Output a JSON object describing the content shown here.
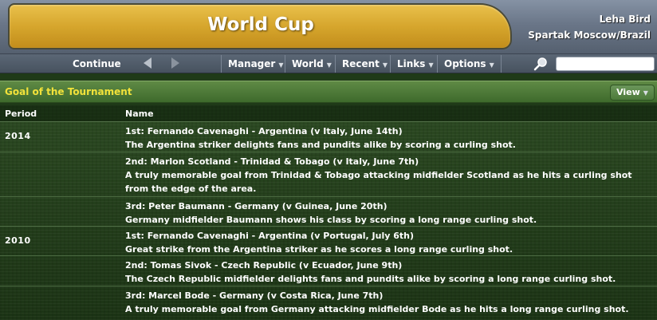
{
  "header": {
    "title": "World Cup",
    "user_name": "Leha Bird",
    "user_team": "Spartak Moscow/Brazil"
  },
  "toolbar": {
    "continue_label": "Continue",
    "menus": [
      "Manager",
      "World",
      "Recent",
      "Links",
      "Options"
    ],
    "search_placeholder": ""
  },
  "section": {
    "title": "Goal of the Tournament",
    "view_label": "View"
  },
  "table": {
    "columns": [
      "Period",
      "Name"
    ],
    "rows": [
      {
        "period": "2014",
        "lines": [
          "1st: Fernando Cavenaghi - Argentina (v Italy, June 14th)",
          "The Argentina striker delights fans and pundits alike by scoring a curling shot."
        ]
      },
      {
        "period": "",
        "lines": [
          "2nd: Marlon Scotland - Trinidad & Tobago (v Italy, June 7th)",
          "A truly memorable goal from Trinidad & Tobago attacking midfielder Scotland as he hits a curling shot",
          "from the edge of the area."
        ]
      },
      {
        "period": "",
        "lines": [
          "3rd: Peter Baumann - Germany (v Guinea, June 20th)",
          "Germany midfielder Baumann shows his class by scoring a long range curling shot."
        ]
      },
      {
        "period": "2010",
        "lines": [
          "1st: Fernando Cavenaghi - Argentina (v Portugal, July 6th)",
          "Great strike from the Argentina striker as he scores a long range curling shot."
        ]
      },
      {
        "period": "",
        "lines": [
          "2nd: Tomas Sivok - Czech Republic (v Ecuador, June 9th)",
          "The Czech Republic midfielder delights fans and pundits alike by scoring a long range curling shot."
        ]
      },
      {
        "period": "",
        "lines": [
          "3rd: Marcel Bode - Germany (v Costa Rica, June 7th)",
          "A truly memorable goal from Germany attacking midfielder Bode as he hits a long range curling shot."
        ]
      }
    ]
  }
}
